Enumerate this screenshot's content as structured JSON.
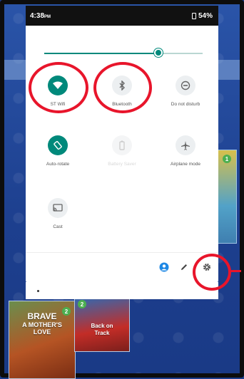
{
  "status_bar": {
    "time": "4:38",
    "time_suffix": "PM",
    "battery": "54%"
  },
  "brightness": {
    "level": 0.72
  },
  "tiles": [
    {
      "label": "ST Wifi",
      "icon": "wifi-icon",
      "state": "on"
    },
    {
      "label": "Bluetooth",
      "icon": "bluetooth-icon",
      "state": "off"
    },
    {
      "label": "Do not disturb",
      "icon": "do-not-disturb-icon",
      "state": "off"
    },
    {
      "label": "Auto-rotate",
      "icon": "auto-rotate-icon",
      "state": "on"
    },
    {
      "label": "Battery Saver",
      "icon": "battery-saver-icon",
      "state": "disabled"
    },
    {
      "label": "Airplane mode",
      "icon": "airplane-icon",
      "state": "off"
    },
    {
      "label": "Cast",
      "icon": "cast-icon",
      "state": "off"
    }
  ],
  "footer": {
    "icons": [
      "user-icon",
      "pencil-icon",
      "gear-icon"
    ]
  },
  "background_books": [
    {
      "title_line1": "BRAVE",
      "title_line2": "A MOTHER'S",
      "title_line3": "LOVE",
      "badge": "2"
    },
    {
      "title_line1": "Back on",
      "title_line2": "Track",
      "badge": "2"
    }
  ],
  "right_card_badge": "1",
  "colors": {
    "accent": "#00897b",
    "annotation": "#e8152b",
    "wallpaper": "#1d3f8e"
  }
}
